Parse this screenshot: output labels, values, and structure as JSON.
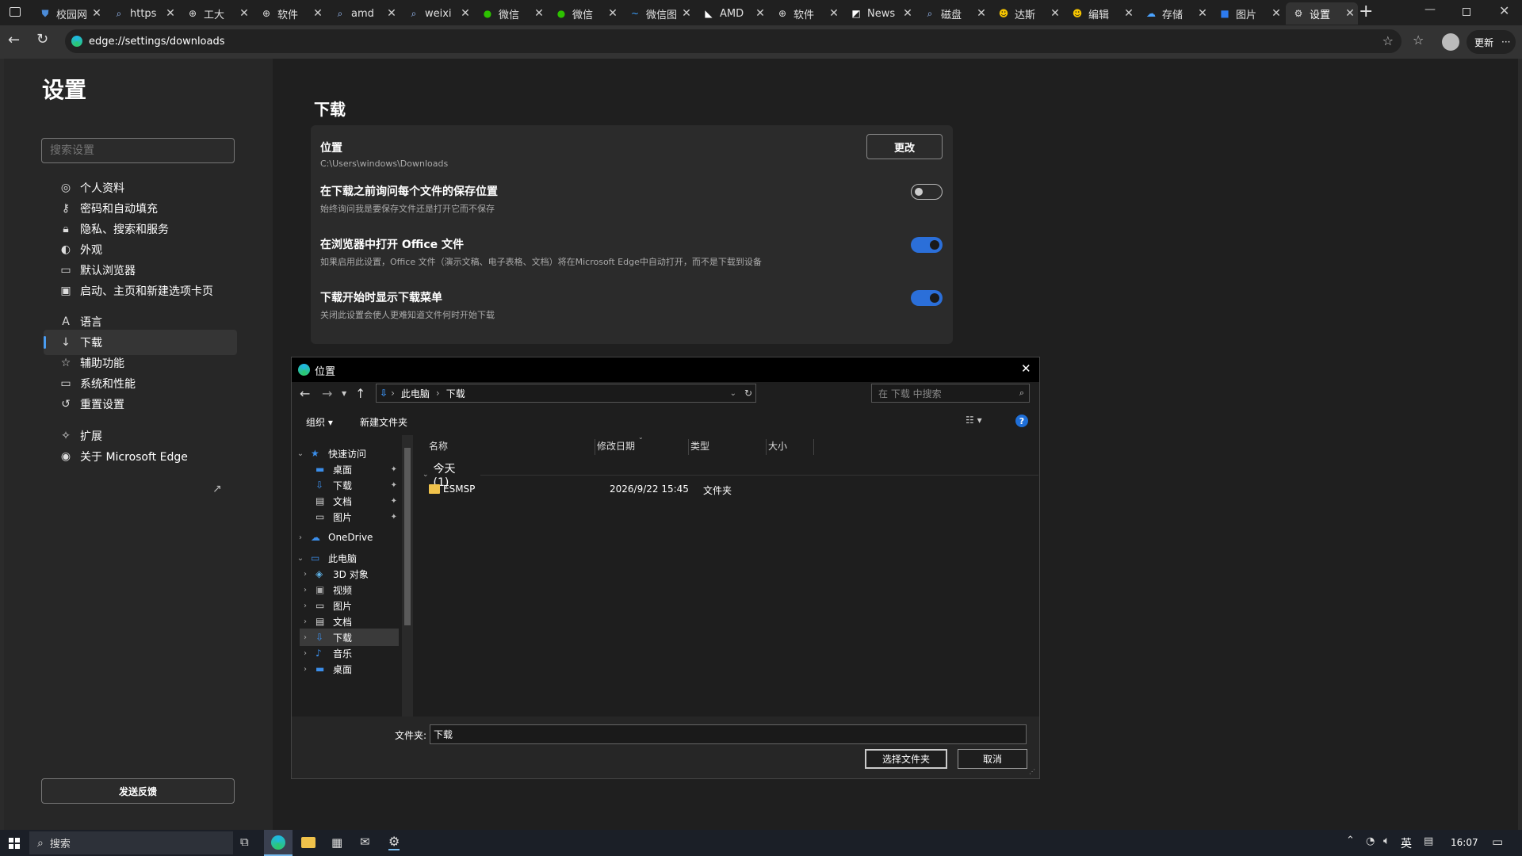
{
  "tabs": [
    {
      "label": "校园网",
      "icon": "shield-icon",
      "color": "#4b8bd8"
    },
    {
      "label": "https",
      "icon": "search-icon",
      "color": "#9ec3ff"
    },
    {
      "label": "工大",
      "icon": "globe-icon",
      "color": "#ddd"
    },
    {
      "label": "软件",
      "icon": "globe-icon",
      "color": "#ddd"
    },
    {
      "label": "amd",
      "icon": "search-icon",
      "color": "#9ec3ff"
    },
    {
      "label": "weixi",
      "icon": "search-icon",
      "color": "#9ec3ff"
    },
    {
      "label": "微信",
      "icon": "wechat-icon",
      "color": "#2dc100"
    },
    {
      "label": "微信",
      "icon": "wechat-icon",
      "color": "#2dc100"
    },
    {
      "label": "微信图",
      "icon": "tilde-icon",
      "color": "#3aa0ff"
    },
    {
      "label": "AMD",
      "icon": "amd-icon",
      "color": "#fff"
    },
    {
      "label": "软件",
      "icon": "globe-icon",
      "color": "#ddd"
    },
    {
      "label": "News",
      "icon": "news-icon",
      "color": "#fff"
    },
    {
      "label": "磁盘",
      "icon": "search-icon",
      "color": "#9ec3ff"
    },
    {
      "label": "达斯",
      "icon": "emoji-icon",
      "color": "#f5c400"
    },
    {
      "label": "编辑",
      "icon": "emoji-icon",
      "color": "#f5c400"
    },
    {
      "label": "存储",
      "icon": "cloud-icon",
      "color": "#4aa3ff"
    },
    {
      "label": "图片",
      "icon": "square-icon",
      "color": "#2d7bf0"
    },
    {
      "label": "设置",
      "icon": "gear-icon",
      "color": "#ddd"
    }
  ],
  "address": {
    "url": "edge://settings/downloads",
    "update_label": "更新"
  },
  "settings": {
    "title": "设置",
    "search_placeholder": "搜索设置",
    "nav": [
      {
        "label": "个人资料",
        "icon": "profile-icon",
        "glyph": "◎"
      },
      {
        "label": "密码和自动填充",
        "icon": "key-icon",
        "glyph": "⚷"
      },
      {
        "label": "隐私、搜索和服务",
        "icon": "lock-icon",
        "glyph": "🔒︎"
      },
      {
        "label": "外观",
        "icon": "appearance-icon",
        "glyph": "◐"
      },
      {
        "label": "默认浏览器",
        "icon": "browser-icon",
        "glyph": "▭"
      },
      {
        "label": "启动、主页和新建选项卡页",
        "icon": "startup-icon",
        "glyph": "▣"
      },
      {
        "label": "语言",
        "icon": "language-icon",
        "glyph": "A"
      },
      {
        "label": "下载",
        "icon": "download-icon",
        "glyph": "↓"
      },
      {
        "label": "辅助功能",
        "icon": "accessibility-icon",
        "glyph": "☆"
      },
      {
        "label": "系统和性能",
        "icon": "system-icon",
        "glyph": "▭"
      },
      {
        "label": "重置设置",
        "icon": "reset-icon",
        "glyph": "↺"
      },
      {
        "label": "扩展",
        "icon": "extensions-icon",
        "glyph": "✧"
      },
      {
        "label": "关于 Microsoft Edge",
        "icon": "edge-icon",
        "glyph": "◉"
      }
    ],
    "feedback_label": "发送反馈",
    "page_title": "下载",
    "location": {
      "title": "位置",
      "path": "C:\\Users\\windows\\Downloads",
      "change_label": "更改"
    },
    "toggles": [
      {
        "title": "在下载之前询问每个文件的保存位置",
        "desc": "始终询问我是要保存文件还是打开它而不保存",
        "on": false
      },
      {
        "title": "在浏览器中打开 Office 文件",
        "desc": "如果启用此设置，Office 文件（演示文稿、电子表格、文档）将在Microsoft Edge中自动打开，而不是下载到设备",
        "on": true
      },
      {
        "title": "下载开始时显示下载菜单",
        "desc": "关闭此设置会使人更难知道文件何时开始下载",
        "on": true
      }
    ]
  },
  "dialog": {
    "title": "位置",
    "breadcrumb": [
      "此电脑",
      "下载"
    ],
    "search_placeholder": "在 下载 中搜索",
    "organize_label": "组织 ▾",
    "new_folder_label": "新建文件夹",
    "columns": [
      "名称",
      "修改日期",
      "类型",
      "大小"
    ],
    "group_label": "今天 (1)",
    "files": [
      {
        "name": "ESMSP",
        "date": "2026/9/22 15:45",
        "type": "文件夹",
        "size": ""
      }
    ],
    "tree": [
      {
        "label": "快速访问",
        "level": 0,
        "expanded": true,
        "icon": "star-icon"
      },
      {
        "label": "桌面",
        "level": 1,
        "pinned": true,
        "icon": "desktop-icon"
      },
      {
        "label": "下载",
        "level": 1,
        "pinned": true,
        "icon": "download-folder-icon"
      },
      {
        "label": "文档",
        "level": 1,
        "pinned": true,
        "icon": "documents-icon"
      },
      {
        "label": "图片",
        "level": 1,
        "pinned": true,
        "icon": "pictures-icon"
      },
      {
        "label": "OneDrive",
        "level": 0,
        "expanded": false,
        "icon": "onedrive-icon"
      },
      {
        "label": "此电脑",
        "level": 0,
        "expanded": true,
        "icon": "pc-icon"
      },
      {
        "label": "3D 对象",
        "level": 1,
        "icon": "3d-objects-icon"
      },
      {
        "label": "视频",
        "level": 1,
        "icon": "videos-icon"
      },
      {
        "label": "图片",
        "level": 1,
        "icon": "pictures-icon"
      },
      {
        "label": "文档",
        "level": 1,
        "icon": "documents-icon"
      },
      {
        "label": "下载",
        "level": 1,
        "icon": "download-folder-icon",
        "selected": true
      },
      {
        "label": "音乐",
        "level": 1,
        "icon": "music-icon"
      },
      {
        "label": "桌面",
        "level": 1,
        "icon": "desktop-icon"
      }
    ],
    "folder_label": "文件夹:",
    "folder_value": "下载",
    "select_label": "选择文件夹",
    "cancel_label": "取消"
  },
  "taskbar": {
    "search_placeholder": "搜索",
    "ime": "英",
    "time": "16:07"
  }
}
